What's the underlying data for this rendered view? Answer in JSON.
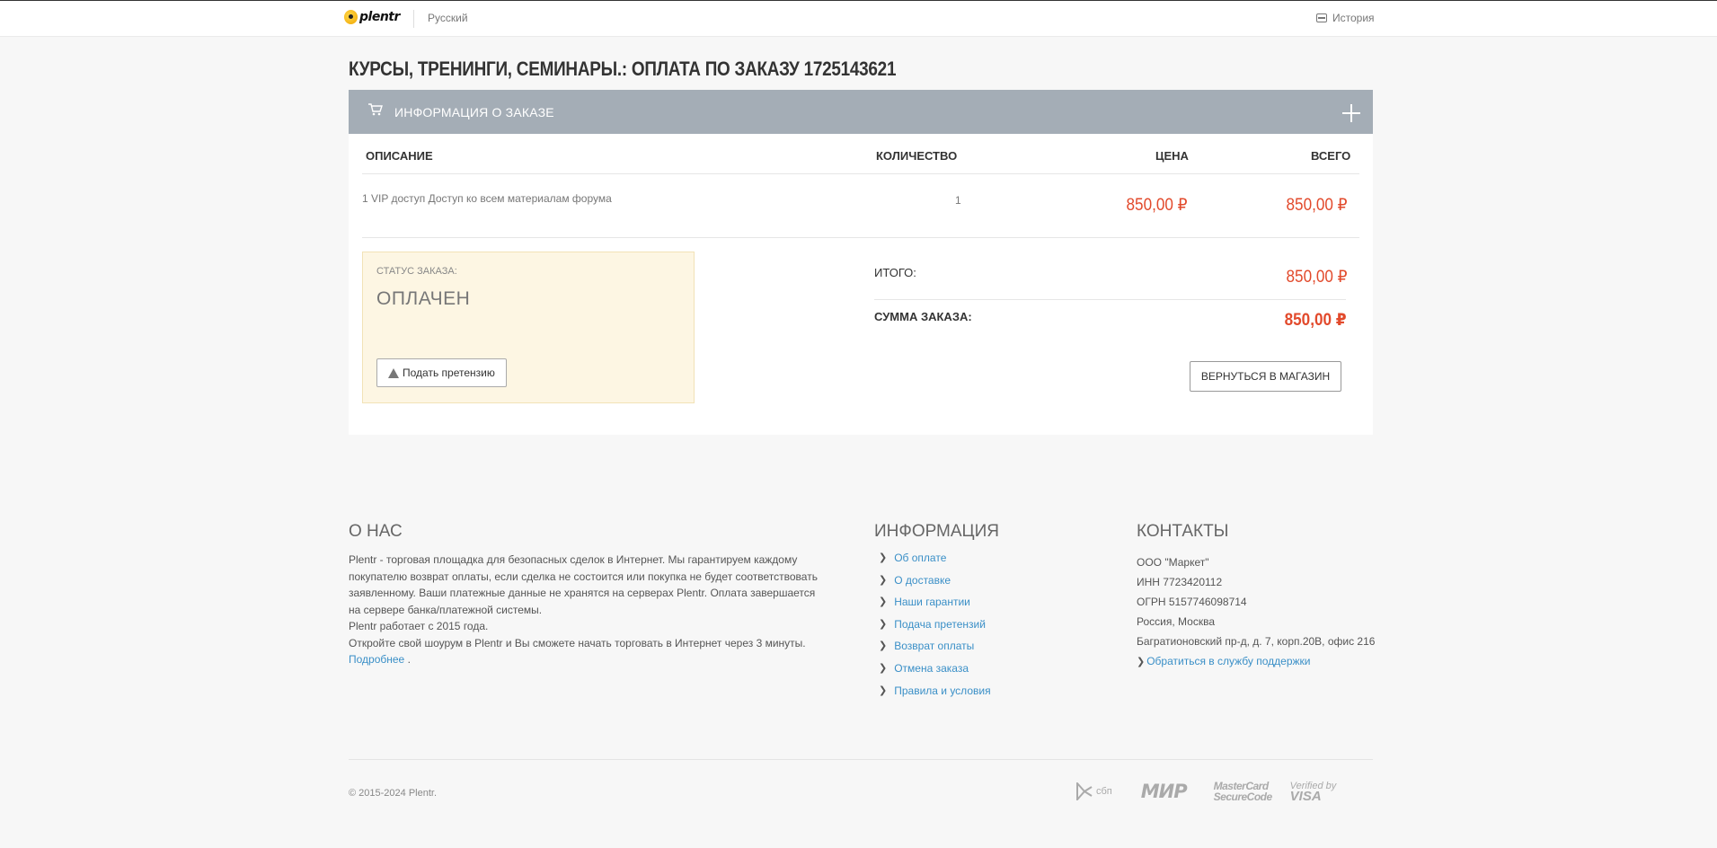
{
  "header": {
    "logo_text": "plentr",
    "language": "Русский",
    "history": "История"
  },
  "page_title": "КУРСЫ, ТРЕНИНГИ, СЕМИНАРЫ.: ОПЛАТА ПО ЗАКАЗУ 1725143621",
  "order_panel": {
    "title": "ИНФОРМАЦИЯ О ЗАКАЗЕ",
    "columns": {
      "description": "ОПИСАНИЕ",
      "quantity": "КОЛИЧЕСТВО",
      "price": "ЦЕНА",
      "total": "ВСЕГО"
    },
    "items": [
      {
        "description": "1 VIP доступ Доступ ко всем материалам форума",
        "quantity": "1",
        "price": "850,00 ₽",
        "total": "850,00 ₽"
      }
    ],
    "status": {
      "label": "СТАТУС ЗАКАЗА:",
      "value": "ОПЛАЧЕН",
      "claim_button": "Подать претензию"
    },
    "summary": {
      "subtotal_label": "ИТОГО:",
      "subtotal_value": "850,00 ₽",
      "order_sum_label": "СУММА ЗАКАЗА:",
      "order_sum_value": "850,00 ₽"
    },
    "back_button": "ВЕРНУТЬСЯ В МАГАЗИН"
  },
  "footer": {
    "about": {
      "title": "О НАС",
      "paragraph": "Plentr - торговая площадка для безопасных сделок в Интернет. Мы гарантируем каждому покупателю возврат оплаты, если сделка не состоится или покупка не будет соответствовать заявленному. Ваши платежные данные не хранятся на серверах Plentr. Оплата завершается на сервере банка/платежной системы.",
      "since": "Plentr работает с 2015 года.",
      "cta": "Откройте свой шоурум в Plentr и Вы сможете начать торговать в Интернет через 3 минуты.",
      "more_link": "Подробнее",
      "more_suffix": "."
    },
    "info": {
      "title": "ИНФОРМАЦИЯ",
      "links": [
        "Об оплате",
        "О доставке",
        "Наши гарантии",
        "Подача претензий",
        "Возврат оплаты",
        "Отмена заказа",
        "Правила и условия"
      ]
    },
    "contacts": {
      "title": "КОНТАКТЫ",
      "company": "ООО \"Маркет\"",
      "inn": "ИНН 7723420112",
      "ogrn": "ОГРН 5157746098714",
      "city": "Россия, Москва",
      "address": "Багратионовский пр-д, д. 7, корп.20В, офис 216",
      "support_link": "Обратиться в службу поддержки"
    },
    "copyright": "© 2015-2024 Plentr.",
    "payment_logos": {
      "sbp": "сбп",
      "mir": "МИР",
      "mastercard_line1": "MasterCard",
      "mastercard_line2": "SecureCode",
      "visa_line1": "Verified by",
      "visa_line2": "VISA"
    }
  }
}
